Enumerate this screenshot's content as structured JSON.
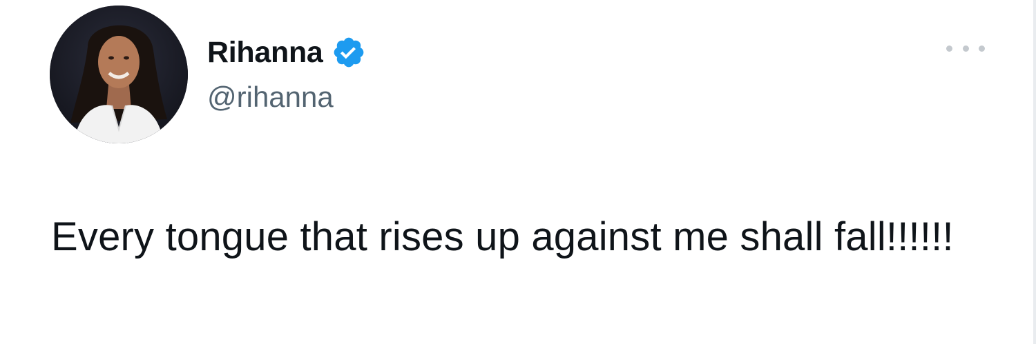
{
  "tweet": {
    "author": {
      "display_name": "Rihanna",
      "handle": "@rihanna",
      "verified": true,
      "avatar_icon": "profile-photo",
      "verified_icon": "verified-badge-icon",
      "verified_color": "#1d9bf0"
    },
    "menu_icon": "more-options-icon",
    "text": "Every tongue that rises up against me shall fall!!!!!!"
  },
  "colors": {
    "text_primary": "#0f1419",
    "text_secondary": "#536471",
    "background": "#ffffff"
  }
}
